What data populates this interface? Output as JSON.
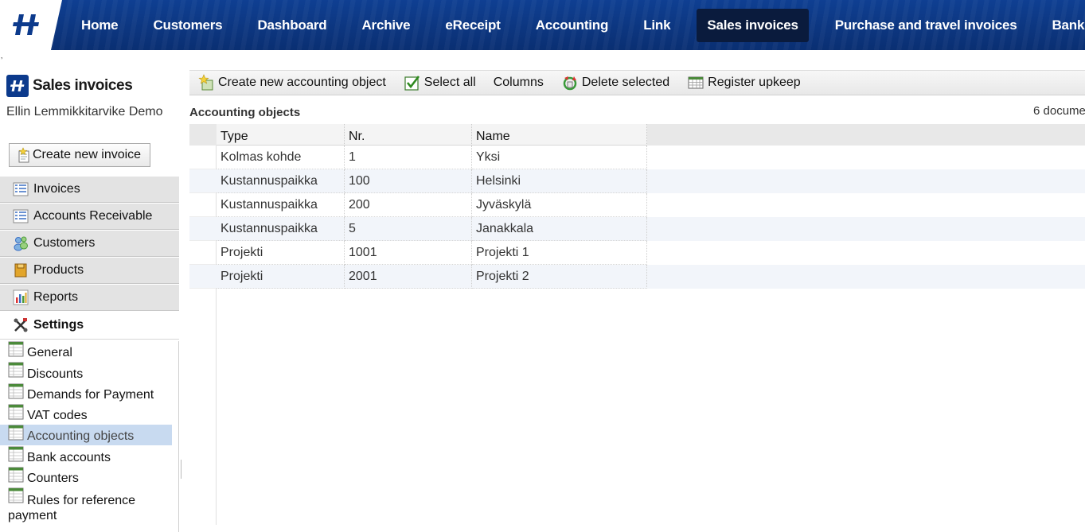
{
  "topnav": {
    "items": [
      {
        "label": "Home"
      },
      {
        "label": "Customers"
      },
      {
        "label": "Dashboard"
      },
      {
        "label": "Archive"
      },
      {
        "label": "eReceipt"
      },
      {
        "label": "Accounting"
      },
      {
        "label": "Link"
      },
      {
        "label": "Sales invoices",
        "active": true
      },
      {
        "label": "Purchase and travel invoices"
      },
      {
        "label": "Bank"
      }
    ]
  },
  "tick": "’",
  "sidebar": {
    "app_title": "Sales invoices",
    "company": "Ellin Lemmikkitarvike Demo",
    "create_invoice_label": "Create new invoice",
    "modules": [
      {
        "label": "Invoices",
        "icon": "list-icon"
      },
      {
        "label": "Accounts Receivable",
        "icon": "list-icon"
      },
      {
        "label": "Customers",
        "icon": "people-icon"
      },
      {
        "label": "Products",
        "icon": "box-icon"
      },
      {
        "label": "Reports",
        "icon": "bar-chart-icon"
      },
      {
        "label": "Settings",
        "icon": "tools-icon"
      }
    ],
    "settings_items": [
      {
        "label": "General"
      },
      {
        "label": "Discounts"
      },
      {
        "label": "Demands for Payment"
      },
      {
        "label": "VAT codes"
      },
      {
        "label": "Accounting objects",
        "selected": true
      },
      {
        "label": "Bank accounts"
      },
      {
        "label": "Counters"
      },
      {
        "label": "Rules for reference payment"
      }
    ]
  },
  "toolbar": {
    "create_label": "Create new accounting object",
    "select_all_label": "Select all",
    "columns_label": "Columns",
    "delete_label": "Delete selected",
    "register_label": "Register upkeep"
  },
  "main": {
    "section_title": "Accounting objects",
    "doc_count": "6 docume"
  },
  "table": {
    "headers": [
      "Type",
      "Nr.",
      "Name"
    ],
    "rows": [
      [
        "Kolmas kohde",
        "1",
        "Yksi"
      ],
      [
        "Kustannuspaikka",
        "100",
        "Helsinki"
      ],
      [
        "Kustannuspaikka",
        "200",
        "Jyväskylä"
      ],
      [
        "Kustannuspaikka",
        "5",
        "Janakkala"
      ],
      [
        "Projekti",
        "1001",
        "Projekti 1"
      ],
      [
        "Projekti",
        "2001",
        "Projekti 2"
      ]
    ]
  },
  "colors": {
    "nav_bg": "#0c3a8c",
    "nav_active": "#0a1b3d",
    "selected_setting": "#c8daf0"
  }
}
